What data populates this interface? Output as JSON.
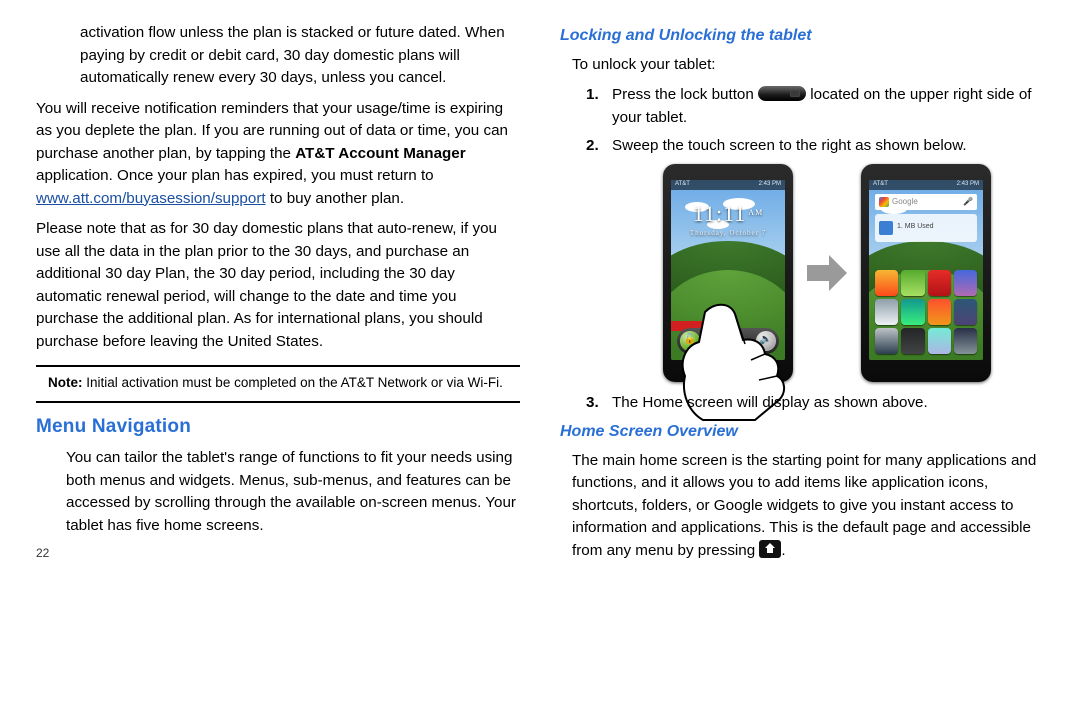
{
  "left": {
    "p1a": "activation flow unless the plan is stacked or future dated. When paying by credit or debit card, 30 day domestic plans will automatically renew every 30 days, unless you cancel.",
    "p2a": "You will receive notification reminders that your usage/time is expiring as you deplete the plan. If you are running out of data or time, you can purchase another plan, by tapping the ",
    "p2bold": "AT&T Account Manager",
    "p2b": " application. Once your plan has expired, you must return to ",
    "p2link": "www.att.com/buyasession/support",
    "p2c": " to buy another plan.",
    "p3": "Please note that as for 30 day domestic plans that auto-renew, if you use all the data in the plan prior to the 30 days, and purchase an additional 30 day Plan, the 30 day period, including the 30 day automatic renewal period, will change to the date and time you purchase the additional plan. As for international plans, you should purchase before leaving the United States.",
    "note_label": "Note:",
    "note_text": " Initial activation must be completed on the AT&T Network or via Wi-Fi.",
    "menu_heading": "Menu Navigation",
    "menu_p": "You can tailor the tablet's range of functions to fit your needs using both menus and widgets. Menus, sub-menus, and features can be accessed by scrolling through the available on-screen menus. Your tablet has five home screens.",
    "pagenum": "22"
  },
  "right": {
    "h_lock": "Locking and Unlocking the tablet",
    "unlock_intro": "To unlock your tablet:",
    "step1a": "Press the lock button ",
    "step1b": " located on the upper right side of your tablet.",
    "step2": "Sweep the touch screen to the right as shown below.",
    "step3": "The Home screen will display as shown above.",
    "h_home": "Home Screen Overview",
    "home_p_a": "The main home screen is the starting point for many applications and functions, and it allows you to add items like application icons, shortcuts, folders, or Google widgets to give you instant access to information and applications. This is the default page and accessible from any menu by pressing ",
    "home_p_b": ".",
    "lockscreen": {
      "carrier": "AT&T",
      "time_right": "2:43 PM",
      "clock": "11:11",
      "ampm": "AM",
      "date": "Thursday, October 7"
    },
    "homescreen": {
      "search_placeholder": "Google",
      "widget_text": "1. MB Used"
    }
  }
}
